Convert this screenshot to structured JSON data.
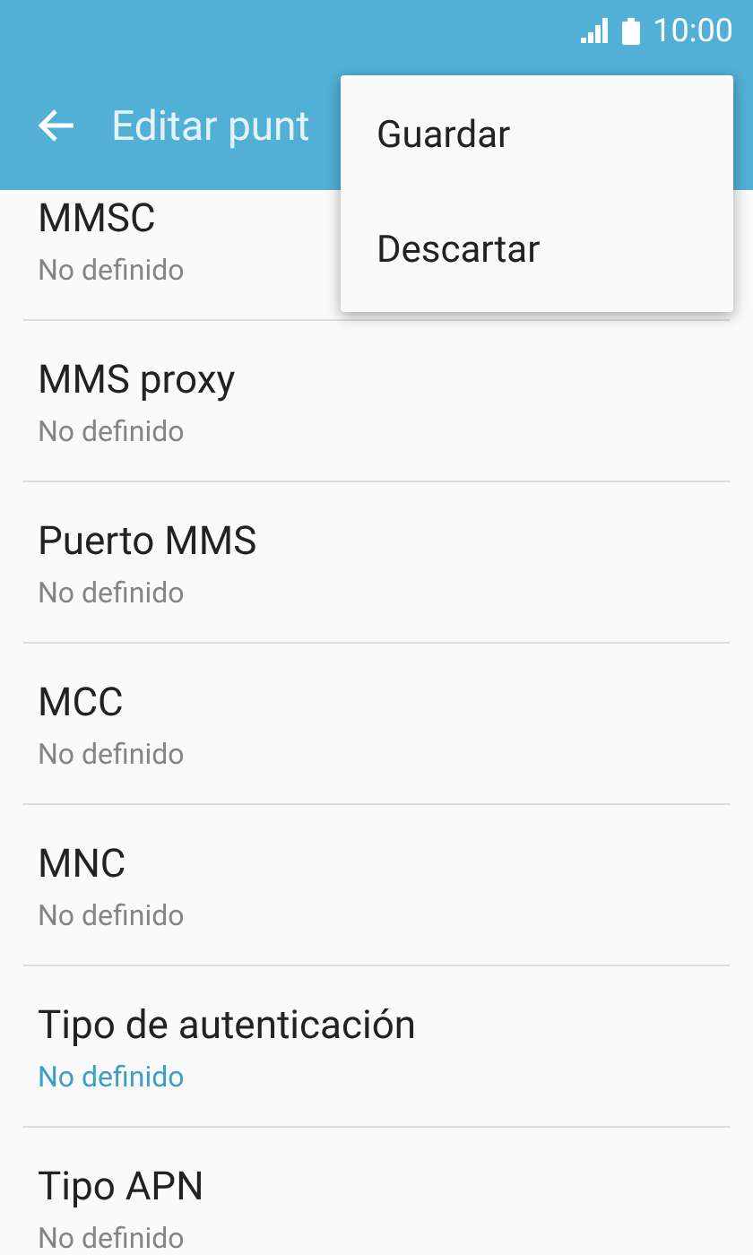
{
  "status_bar": {
    "time": "10:00"
  },
  "app_bar": {
    "title": "Editar punt"
  },
  "settings": [
    {
      "title": "MMSC",
      "value": "No definido",
      "kind": "text"
    },
    {
      "title": "MMS proxy",
      "value": "No definido",
      "kind": "text"
    },
    {
      "title": "Puerto MMS",
      "value": "No definido",
      "kind": "text"
    },
    {
      "title": "MCC",
      "value": "No definido",
      "kind": "text"
    },
    {
      "title": "MNC",
      "value": "No definido",
      "kind": "text"
    },
    {
      "title": "Tipo de autenticación",
      "value": "No definido",
      "kind": "list"
    },
    {
      "title": "Tipo APN",
      "value": "No definido",
      "kind": "text"
    }
  ],
  "menu": {
    "items": [
      "Guardar",
      "Descartar"
    ]
  }
}
